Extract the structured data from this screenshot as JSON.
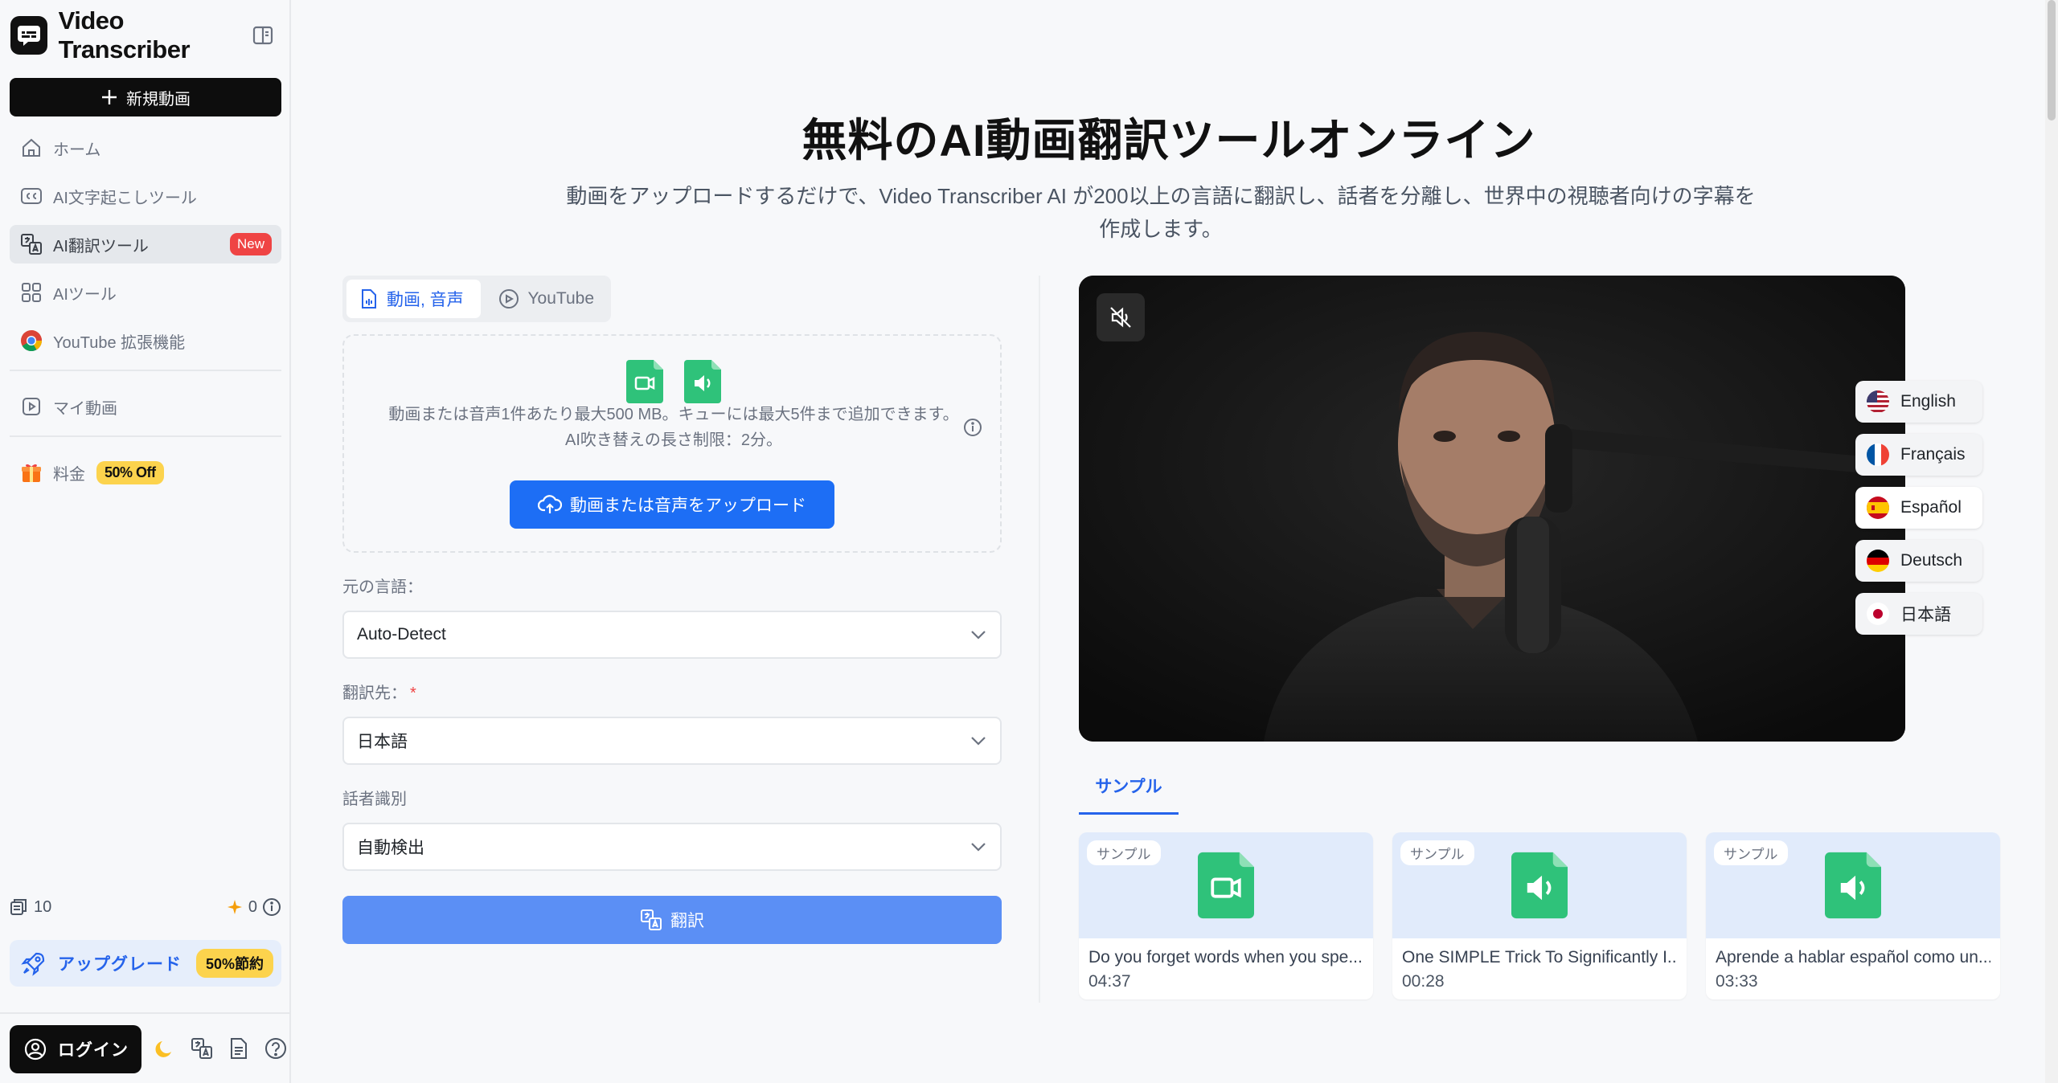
{
  "sidebar": {
    "brand": "Video Transcriber",
    "new_video": "新規動画",
    "items": [
      {
        "label": "ホーム"
      },
      {
        "label": "AI文字起こしツール"
      },
      {
        "label": "AI翻訳ツール",
        "badge": "New"
      },
      {
        "label": "AIツール"
      },
      {
        "label": "YouTube 拡張機能"
      }
    ],
    "my_videos": "マイ動画",
    "pricing": {
      "label": "料金",
      "badge": "50% Off"
    },
    "credits": {
      "count": "10",
      "sparkle": "0"
    },
    "upgrade": {
      "label": "アップグレード",
      "badge": "50%節約"
    },
    "login": "ログイン"
  },
  "hero": {
    "title": "無料のAI動画翻訳ツールオンライン",
    "subtitle": "動画をアップロードするだけで、Video Transcriber AI が200以上の言語に翻訳し、話者を分離し、世界中の視聴者向けの字幕を作成します。"
  },
  "tabs": [
    {
      "label": "動画, 音声"
    },
    {
      "label": "YouTube"
    }
  ],
  "upload": {
    "note_line1": "動画または音声1件あたり最大500 MB。キューには最大5件まで追加できます。",
    "note_line2": "AI吹き替えの長さ制限：2分。",
    "button": "動画または音声をアップロード"
  },
  "form": {
    "source_label": "元の言語：",
    "source_value": "Auto-Detect",
    "target_label": "翻訳先：",
    "target_required": "*",
    "target_value": "日本語",
    "speaker_label": "話者識別",
    "speaker_value": "自動検出",
    "submit": "翻訳"
  },
  "languages": [
    {
      "label": "English"
    },
    {
      "label": "Français"
    },
    {
      "label": "Español"
    },
    {
      "label": "Deutsch"
    },
    {
      "label": "日本語"
    }
  ],
  "samples": {
    "tab": "サンプル",
    "chip": "サンプル",
    "items": [
      {
        "title": "Do you forget words when you spe...",
        "duration": "04:37",
        "kind": "video"
      },
      {
        "title": "One SIMPLE Trick To Significantly I...",
        "duration": "00:28",
        "kind": "audio"
      },
      {
        "title": "Aprende a hablar español como un...",
        "duration": "03:33",
        "kind": "audio"
      }
    ]
  },
  "colors": {
    "primary": "#1d6ef5",
    "accent_green": "#2fc27a",
    "badge_red": "#ef4444",
    "badge_yellow": "#fcd34d"
  }
}
